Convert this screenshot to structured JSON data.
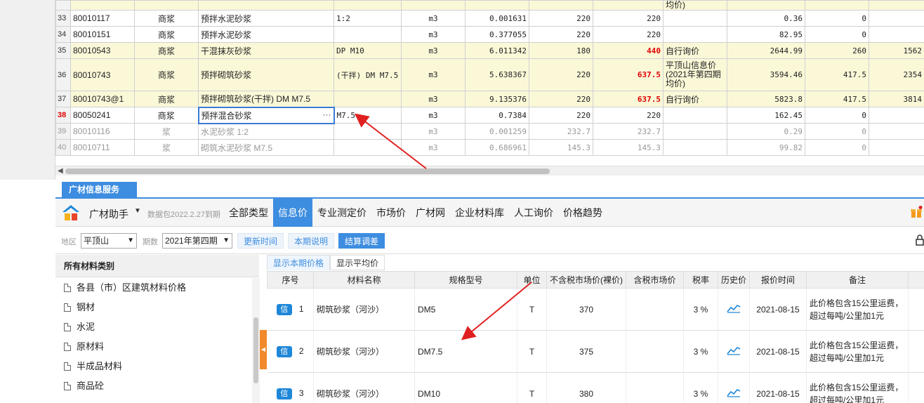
{
  "top_table": {
    "rows": [
      {
        "num": "",
        "code": "",
        "type": "",
        "name": "",
        "spec": "",
        "unit": "",
        "qty": "",
        "price1": "",
        "price2": "",
        "source": "均价)",
        "total": "",
        "diff": "",
        "extra": "",
        "style": "yellow"
      },
      {
        "num": "33",
        "code": "80010117",
        "type": "商浆",
        "name": "预拌水泥砂浆",
        "spec": "1:2",
        "unit": "m3",
        "qty": "0.001631",
        "price1": "220",
        "price2": "220",
        "source": "",
        "total": "0.36",
        "diff": "0",
        "extra": "",
        "style": "normal"
      },
      {
        "num": "34",
        "code": "80010151",
        "type": "商浆",
        "name": "预拌水泥砂浆",
        "spec": "",
        "unit": "m3",
        "qty": "0.377055",
        "price1": "220",
        "price2": "220",
        "source": "",
        "total": "82.95",
        "diff": "0",
        "extra": "",
        "style": "normal"
      },
      {
        "num": "35",
        "code": "80010543",
        "type": "商浆",
        "name": "干混抹灰砂浆",
        "spec": "DP M10",
        "unit": "m3",
        "qty": "6.011342",
        "price1": "180",
        "price2": "440",
        "source": "自行询价",
        "total": "2644.99",
        "diff": "260",
        "extra": "1562",
        "style": "yellow"
      },
      {
        "num": "36",
        "code": "80010743",
        "type": "商浆",
        "name": "预拌砌筑砂浆",
        "spec": "(干拌) DM M7.5",
        "unit": "m3",
        "qty": "5.638367",
        "price1": "220",
        "price2": "637.5",
        "source": "平顶山信息价(2021年第四期均价)",
        "total": "3594.46",
        "diff": "417.5",
        "extra": "2354",
        "style": "yellow"
      },
      {
        "num": "37",
        "code": "80010743@1",
        "type": "商浆",
        "name": "预拌砌筑砂浆(干拌) DM M7.5",
        "spec": "",
        "unit": "m3",
        "qty": "9.135376",
        "price1": "220",
        "price2": "637.5",
        "source": "自行询价",
        "total": "5823.8",
        "diff": "417.5",
        "extra": "3814",
        "style": "yellow"
      },
      {
        "num": "38",
        "code": "80050241",
        "type": "商浆",
        "name": "预拌混合砂浆",
        "spec": "M7.5",
        "unit": "m3",
        "qty": "0.7384",
        "price1": "220",
        "price2": "220",
        "source": "",
        "total": "162.45",
        "diff": "0",
        "extra": "",
        "style": "active"
      },
      {
        "num": "39",
        "code": "80010116",
        "type": "浆",
        "name": "水泥砂浆 1:2",
        "spec": "",
        "unit": "m3",
        "qty": "0.001259",
        "price1": "232.7",
        "price2": "232.7",
        "source": "",
        "total": "0.29",
        "diff": "0",
        "extra": "",
        "style": "grey"
      },
      {
        "num": "40",
        "code": "80010711",
        "type": "浆",
        "name": "砌筑水泥砂浆 M7.5",
        "spec": "",
        "unit": "m3",
        "qty": "0.686961",
        "price1": "145.3",
        "price2": "145.3",
        "source": "",
        "total": "99.82",
        "diff": "0",
        "extra": "",
        "style": "grey"
      }
    ],
    "cell_more": "···"
  },
  "panel": {
    "tab_label": "广材信息服务",
    "brand": "广材助手",
    "package_note": "数据包2022.2.27到期",
    "menu": [
      "全部类型",
      "信息价",
      "专业测定价",
      "市场价",
      "广材网",
      "企业材料库",
      "人工询价",
      "价格趋势"
    ],
    "active_menu": "信息价"
  },
  "filter": {
    "region_label": "地区",
    "region_value": "平顶山",
    "period_label": "期数",
    "period_value": "2021年第四期",
    "btn_update": "更新时间",
    "btn_explain": "本期说明",
    "btn_settle": "结算调差"
  },
  "categories": {
    "title": "所有材料类别",
    "items": [
      "各县（市）区建筑材料价格",
      "钢材",
      "水泥",
      "原材料",
      "半成品材料",
      "商品砼"
    ]
  },
  "price": {
    "subtabs": [
      "显示本期价格",
      "显示平均价"
    ],
    "headers": [
      "序号",
      "材料名称",
      "规格型号",
      "单位",
      "不含税市场价(裸价)",
      "含税市场价",
      "税率",
      "历史价",
      "报价时间",
      "备注"
    ],
    "badge": "信",
    "rows": [
      {
        "idx": "1",
        "name": "砌筑砂浆（河沙）",
        "spec": "DM5",
        "unit": "T",
        "price": "370",
        "tax_price": "",
        "rate": "3 %",
        "date": "2021-08-15",
        "note1": "此价格包含15公里运费，",
        "note2": "超过每吨/公里加1元"
      },
      {
        "idx": "2",
        "name": "砌筑砂浆（河沙）",
        "spec": "DM7.5",
        "unit": "T",
        "price": "375",
        "tax_price": "",
        "rate": "3 %",
        "date": "2021-08-15",
        "note1": "此价格包含15公里运费，",
        "note2": "超过每吨/公里加1元"
      },
      {
        "idx": "3",
        "name": "砌筑砂浆（河沙）",
        "spec": "DM10",
        "unit": "T",
        "price": "380",
        "tax_price": "",
        "rate": "3 %",
        "date": "2021-08-15",
        "note1": "此价格包含15公里运费，",
        "note2": "超过每吨/公里加1元"
      }
    ]
  },
  "colors": {
    "accent": "#3d8de0",
    "highlight_row": "#fbf8d8",
    "red_value": "#e00000",
    "annotation_arrow": "#e02020"
  }
}
